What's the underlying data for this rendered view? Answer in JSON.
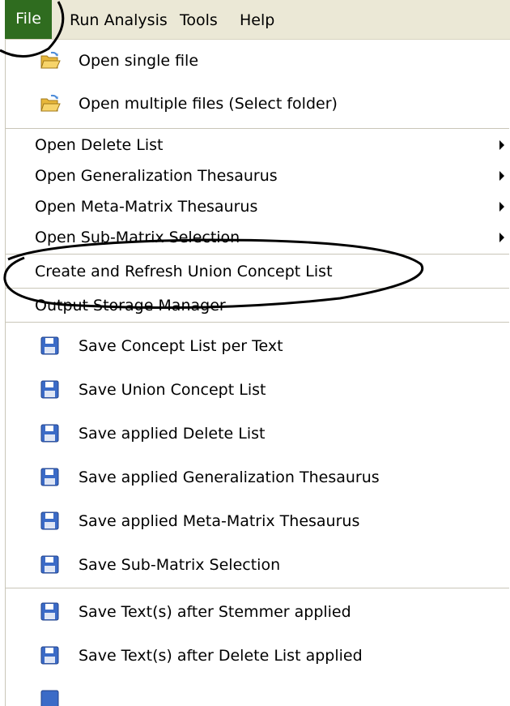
{
  "menubar": {
    "file": "File",
    "run_analysis": "Run Analysis",
    "tools": "Tools",
    "help": "Help"
  },
  "menu": {
    "open_single": "Open single file",
    "open_multiple": "Open multiple files (Select folder)",
    "open_delete_list": "Open Delete List",
    "open_generalization": "Open Generalization Thesaurus",
    "open_meta_matrix": "Open Meta-Matrix Thesaurus",
    "open_sub_matrix": "Open Sub-Matrix Selection",
    "create_refresh": "Create and Refresh Union Concept List",
    "output_storage": "Output Storage Manager",
    "save_concept_per_text": "Save Concept List per Text",
    "save_union_concept": "Save Union Concept List",
    "save_applied_delete": "Save applied Delete List",
    "save_applied_generalization": "Save applied Generalization Thesaurus",
    "save_applied_meta_matrix": "Save applied Meta-Matrix Thesaurus",
    "save_sub_matrix": "Save Sub-Matrix Selection",
    "save_after_stemmer": "Save Text(s) after Stemmer applied",
    "save_after_delete": "Save Text(s) after Delete List applied"
  },
  "icons": {
    "open_folder": "open-folder-icon",
    "save_disk": "floppy-disk-icon",
    "submenu_arrow": "submenu-arrow-icon"
  },
  "colors": {
    "menubar_bg": "#ebe8d6",
    "file_highlight": "#2f6c1f",
    "separator": "#c9c6b8",
    "annotation": "#000000"
  }
}
